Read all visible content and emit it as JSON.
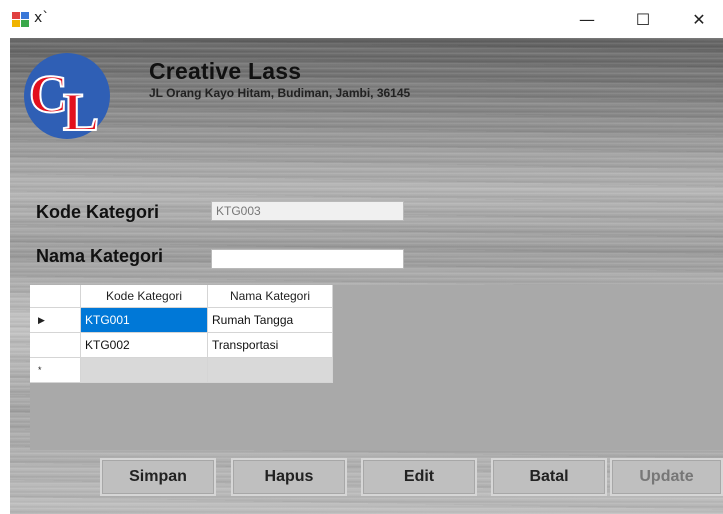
{
  "window": {
    "title": "x`",
    "minimize": "—",
    "maximize": "☐",
    "close": "✕"
  },
  "header": {
    "company_name": "Creative Lass",
    "address": "JL Orang Kayo Hitam, Budiman, Jambi, 36145",
    "logo_text": "CL"
  },
  "form": {
    "kode_label": "Kode Kategori",
    "kode_value": "KTG003",
    "nama_label": "Nama Kategori",
    "nama_value": ""
  },
  "grid": {
    "columns": [
      "Kode Kategori",
      "Nama Kategori"
    ],
    "rows": [
      {
        "indicator": "▶",
        "kode": "KTG001",
        "nama": "Rumah Tangga"
      },
      {
        "indicator": "",
        "kode": "KTG002",
        "nama": "Transportasi"
      }
    ],
    "new_row_indicator": "*"
  },
  "buttons": {
    "simpan": "Simpan",
    "hapus": "Hapus",
    "edit": "Edit",
    "batal": "Batal",
    "update": "Update"
  },
  "colors": {
    "selection": "#0078d7",
    "logo_blue": "#2f5fb5",
    "logo_red": "#e3101c"
  }
}
